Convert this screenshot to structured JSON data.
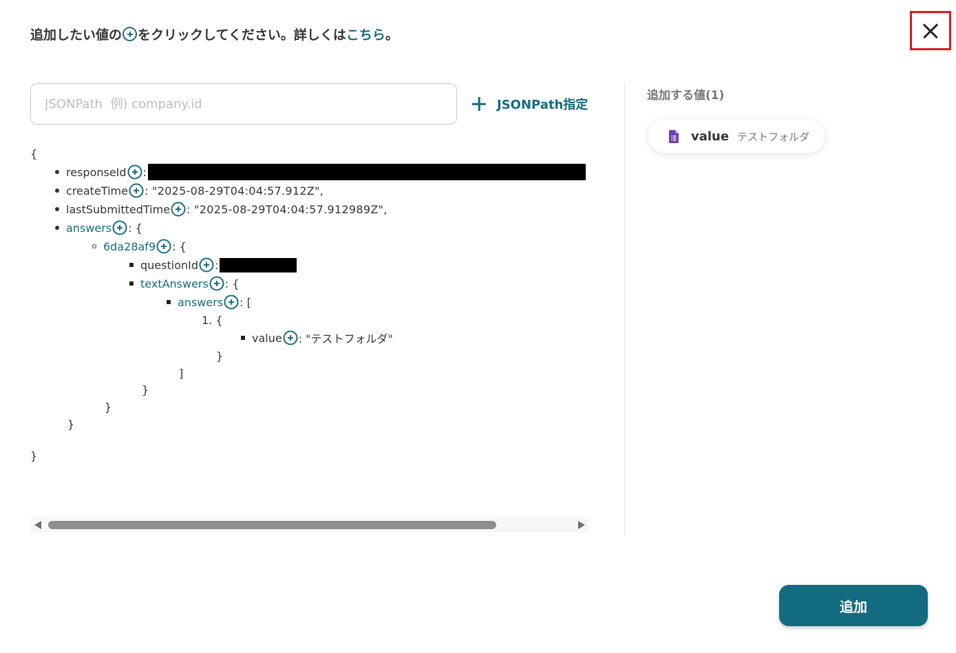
{
  "header": {
    "instruction_before": "追加したい値の",
    "instruction_after": "をクリックしてください。詳しくは",
    "link_text": "こちら",
    "instruction_end": "。",
    "close_icon": "close-icon"
  },
  "search": {
    "placeholder": "JSONPath  例) company.id",
    "value": ""
  },
  "jsonpath_button": {
    "label": "JSONPath指定"
  },
  "json_tree": {
    "open_root": "{",
    "close_root": "}",
    "response_id_key": "responseId",
    "colon": ":",
    "create_time_key": "createTime",
    "create_time_value": ": \"2025-08-29T04:04:57.912Z\",",
    "last_submitted_key": "lastSubmittedTime",
    "last_submitted_value": ": \"2025-08-29T04:04:57.912989Z\",",
    "answers_key": "answers",
    "obj_open": ": {",
    "answer_id_key": "6da28af9",
    "question_id_key": "questionId",
    "text_answers_key": "textAnswers",
    "inner_answers_key": "answers",
    "arr_open": ": [",
    "list_item_open": "1. {",
    "value_key": "value",
    "value_value": ": \"テストフォルダ\"",
    "close_item": "}",
    "close_array": "]",
    "close_text_answers": "}",
    "close_answer_id": "}",
    "close_answers": "}"
  },
  "sidebar": {
    "title": "追加する値(1)",
    "chips": [
      {
        "icon": "google-forms-doc-icon",
        "key": "value",
        "value": "テストフォルダ"
      }
    ]
  },
  "footer": {
    "add_label": "追加"
  },
  "colors": {
    "accent": "#136b80",
    "highlight_border": "#e01818",
    "forms_purple": "#6b3fb5"
  }
}
